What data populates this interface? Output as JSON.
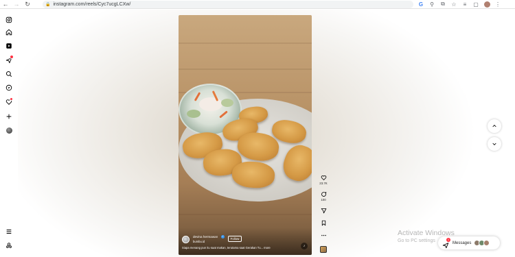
{
  "browser": {
    "url": "instagram.com/reels/Cyc7ucgLCXw/",
    "nav": {
      "back_icon": "arrow-left-icon",
      "forward_icon": "arrow-right-icon",
      "reload_icon": "reload-icon"
    },
    "toolbar_icons": [
      "google-icon",
      "zoom-icon",
      "share-icon",
      "star-icon",
      "tab-search-icon",
      "sidebar-icon",
      "profile-icon"
    ]
  },
  "sidebar": {
    "items": [
      {
        "icon": "instagram-logo-icon"
      },
      {
        "icon": "home-icon"
      },
      {
        "icon": "reels-icon"
      },
      {
        "icon": "messenger-icon",
        "badge": "1"
      },
      {
        "icon": "search-icon"
      },
      {
        "icon": "explore-icon"
      },
      {
        "icon": "heart-icon",
        "badge": "dot"
      },
      {
        "icon": "create-icon"
      },
      {
        "icon": "profile-avatar-icon"
      },
      {
        "icon": "menu-icon"
      },
      {
        "icon": "threads-icon"
      }
    ]
  },
  "reel": {
    "author": "devina hermawan",
    "author_sub": "bumbu.id",
    "follow_label": "Follow",
    "caption": "Siapa menang pun itu saat makan, terutama saat Gerakan Tu... more"
  },
  "actions": {
    "likes": "23.7K",
    "comments": "100"
  },
  "watermark": {
    "line1": "Activate Windows",
    "line2": "Go to PC settings"
  },
  "messages": {
    "label": "Messages",
    "badge": "1"
  },
  "colors": {
    "accent": "#ff3040",
    "verified": "#3897f0"
  }
}
